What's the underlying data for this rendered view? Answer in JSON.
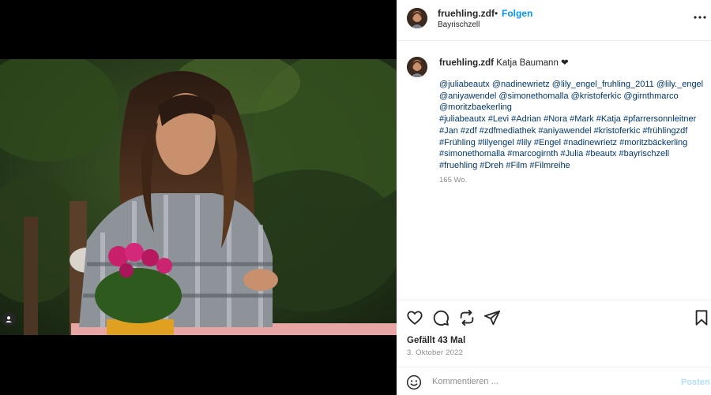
{
  "colors": {
    "accent": "#0095f6",
    "link": "#00376b",
    "muted": "#8e8e8e",
    "post_disabled": "#b2dffc"
  },
  "header": {
    "username": "fruehling.zdf",
    "separator": "•",
    "follow_label": "Folgen",
    "location": "Bayrischzell",
    "more_icon": "more-horizontal-icon"
  },
  "caption": {
    "username": "fruehling.zdf",
    "text": "Katja Baumann ❤",
    "lines": [
      "@juliabeautx @nadinewrietz @lily_engel_fruhling_2011 @lily._engel",
      "@aniyawendel @simonethomalla @kristoferkic @girnthmarco",
      "@moritzbaekerling",
      "#juliabeautx #Levi #Adrian #Nora #Mark #Katja #pfarrersonnleitner",
      "#Jan #zdf #zdfmediathek  #aniyawendel #kristoferkic #frühlingzdf",
      "#Frühling #lilyengel #lily #Engel #nadinewrietz #moritzbäckerling",
      "#simonethomalla #marcogirnth #Julia #beautx #bayrischzell",
      "#fruehling #Dreh #Film #Filmreihe"
    ],
    "time_ago": "165 Wo."
  },
  "actions": {
    "icons": [
      "heart-icon",
      "comment-icon",
      "share-icon",
      "send-icon",
      "bookmark-icon"
    ],
    "likes": "Gefällt 43 Mal",
    "date": "3. Oktober 2022"
  },
  "comment": {
    "placeholder": "Kommentieren ...",
    "post_label": "Posten",
    "emoji_icon": "emoji-icon"
  },
  "media": {
    "user_tag_icon": "user-tag-icon"
  }
}
